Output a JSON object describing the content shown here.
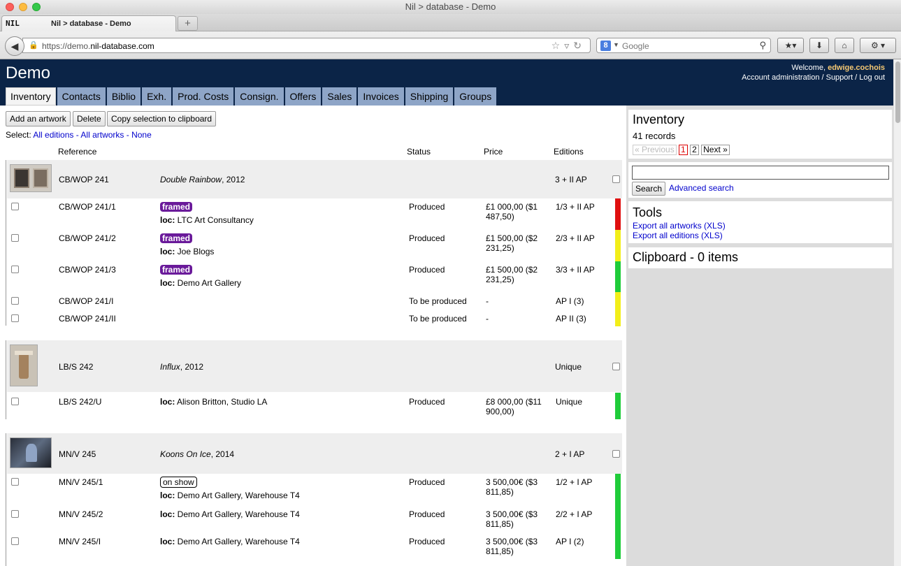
{
  "browser": {
    "window_title": "Nil > database - Demo",
    "tab_favicon_text": "NIL",
    "tab_title": "Nil > database - Demo",
    "new_tab_label": "+",
    "url_prefix": "https://demo.",
    "url_domain": "nil-database.com",
    "search_placeholder": "Google",
    "search_engine_letter": "8"
  },
  "app": {
    "title": "Demo",
    "welcome_prefix": "Welcome, ",
    "username": "edwige.cochois",
    "account_links": "Account administration / Support / Log out",
    "tabs": [
      "Inventory",
      "Contacts",
      "Biblio",
      "Exh.",
      "Prod. Costs",
      "Consign.",
      "Offers",
      "Sales",
      "Invoices",
      "Shipping",
      "Groups"
    ],
    "active_tab": "Inventory"
  },
  "toolbar": {
    "add_label": "Add an artwork",
    "delete_label": "Delete",
    "copy_label": "Copy selection to clipboard",
    "select_prefix": "Select: ",
    "select_all_editions": "All editions",
    "select_sep": " - ",
    "select_all_artworks": "All artworks",
    "select_none": "None"
  },
  "columns": {
    "reference": "Reference",
    "status": "Status",
    "price": "Price",
    "editions": "Editions"
  },
  "artworks": [
    {
      "ref": "CB/WOP 241",
      "title": "Double Rainbow",
      "year": ", 2012",
      "editions": "3 + II AP",
      "items": [
        {
          "ref": "CB/WOP 241/1",
          "badge": "framed",
          "loc_label": "loc:",
          "loc": " LTC Art Consultancy",
          "status": "Produced",
          "price": "£1 000,00 ($1 487,50)",
          "editions": "1/3 + II AP",
          "color": "#e01010"
        },
        {
          "ref": "CB/WOP 241/2",
          "badge": "framed",
          "loc_label": "loc:",
          "loc": " Joe Blogs",
          "status": "Produced",
          "price": "£1 500,00 ($2 231,25)",
          "editions": "2/3 + II AP",
          "color": "#f2ee1a"
        },
        {
          "ref": "CB/WOP 241/3",
          "badge": "framed",
          "loc_label": "loc:",
          "loc": " Demo Art Gallery",
          "status": "Produced",
          "price": "£1 500,00 ($2 231,25)",
          "editions": "3/3 + II AP",
          "color": "#1fcc3a"
        },
        {
          "ref": "CB/WOP 241/I",
          "status": "To be produced",
          "price": "-",
          "editions": "AP I (3)",
          "color": "#f2ee1a"
        },
        {
          "ref": "CB/WOP 241/II",
          "status": "To be produced",
          "price": "-",
          "editions": "AP II (3)",
          "color": "#f2ee1a"
        }
      ]
    },
    {
      "ref": "LB/S 242",
      "title": "Influx",
      "year": ", 2012",
      "editions": "Unique",
      "items": [
        {
          "ref": "LB/S 242/U",
          "loc_label": "loc:",
          "loc": " Alison Britton, Studio LA",
          "status": "Produced",
          "price": "£8 000,00 ($11 900,00)",
          "editions": "Unique",
          "color": "#1fcc3a"
        }
      ]
    },
    {
      "ref": "MN/V 245",
      "title": "Koons On Ice",
      "year": ", 2014",
      "editions": "2 + I AP",
      "items": [
        {
          "ref": "MN/V 245/1",
          "badge": "on show",
          "loc_label": "loc:",
          "loc": " Demo Art Gallery, Warehouse T4",
          "status": "Produced",
          "price": "3 500,00€ ($3 811,85)",
          "editions": "1/2 + I AP",
          "color": "#1fcc3a"
        },
        {
          "ref": "MN/V 245/2",
          "loc_label": "loc:",
          "loc": " Demo Art Gallery, Warehouse T4",
          "status": "Produced",
          "price": "3 500,00€ ($3 811,85)",
          "editions": "2/2 + I AP",
          "color": "#1fcc3a"
        },
        {
          "ref": "MN/V 245/I",
          "loc_label": "loc:",
          "loc": " Demo Art Gallery, Warehouse T4",
          "status": "Produced",
          "price": "3 500,00€ ($3 811,85)",
          "editions": "AP I (2)",
          "color": "#1fcc3a"
        }
      ]
    }
  ],
  "sidebar": {
    "inventory_title": "Inventory",
    "records": "41 records",
    "pager_prev": "« Previous",
    "pager_page1": "1",
    "pager_page2": "2",
    "pager_next": "Next »",
    "search_button": "Search",
    "advanced_search": "Advanced search",
    "tools_title": "Tools",
    "export_artworks": "Export all artworks (XLS)",
    "export_editions": "Export all editions (XLS)",
    "clipboard_title": "Clipboard - 0 items"
  }
}
